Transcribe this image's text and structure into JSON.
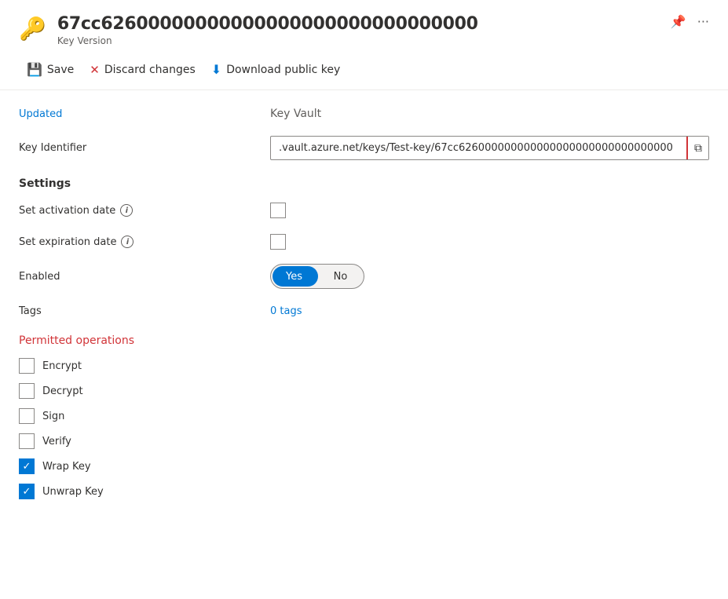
{
  "header": {
    "key_icon": "🔑",
    "title": "67cc62600000000000000000000000000000",
    "subtitle": "Key Version",
    "pin_label": "📌",
    "ellipsis_label": "···"
  },
  "toolbar": {
    "save_label": "Save",
    "discard_label": "Discard changes",
    "download_label": "Download public key"
  },
  "form": {
    "updated_label": "Updated",
    "updated_value": "Key Vault",
    "key_identifier_label": "Key Identifier",
    "key_identifier_value": ".vault.azure.net/keys/Test-key/67cc626000000000000000000000000000000",
    "settings_heading": "Settings",
    "activation_label": "Set activation date",
    "expiration_label": "Set expiration date",
    "enabled_label": "Enabled",
    "toggle_yes": "Yes",
    "toggle_no": "No",
    "tags_label": "Tags",
    "tags_value": "0 tags",
    "permitted_heading": "Permitted operations",
    "operations": [
      {
        "label": "Encrypt",
        "checked": false
      },
      {
        "label": "Decrypt",
        "checked": false
      },
      {
        "label": "Sign",
        "checked": false
      },
      {
        "label": "Verify",
        "checked": false
      },
      {
        "label": "Wrap Key",
        "checked": true
      },
      {
        "label": "Unwrap Key",
        "checked": true
      }
    ]
  }
}
